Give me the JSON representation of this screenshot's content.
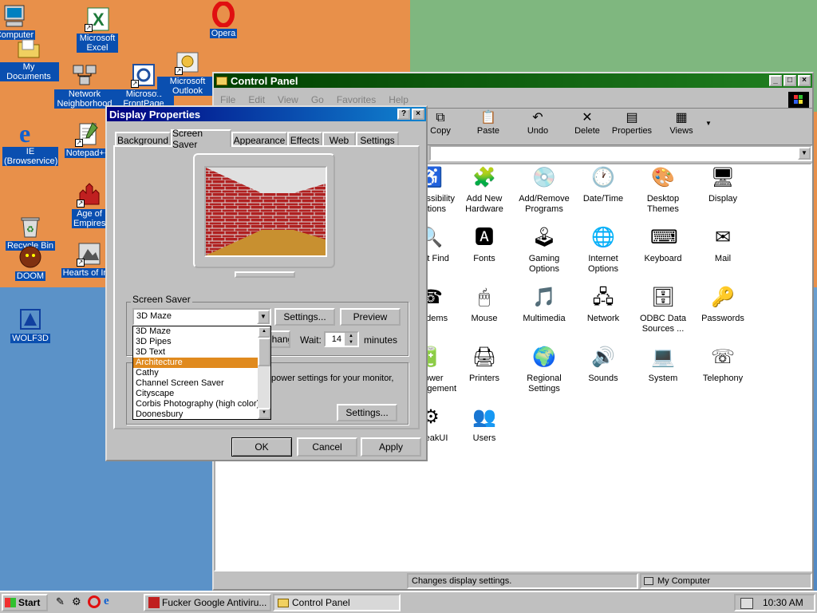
{
  "desktop": {
    "icons": [
      {
        "label": "Computer"
      },
      {
        "label": "My Documents"
      },
      {
        "label": "Microsoft Excel"
      },
      {
        "label": "Opera"
      },
      {
        "label": "Network Neighborhood"
      },
      {
        "label": "Microsoft FrontPage"
      },
      {
        "label": "Microsoft Outlook"
      },
      {
        "label": "IE (Browservice)"
      },
      {
        "label": "Notepad++"
      },
      {
        "label": "Age of Empires"
      },
      {
        "label": "Recycle Bin"
      },
      {
        "label": "DOOM"
      },
      {
        "label": "Hearts of Iron"
      },
      {
        "label": "WOLF3D"
      }
    ]
  },
  "control_panel": {
    "title": "Control Panel",
    "menu": [
      "File",
      "Edit",
      "View",
      "Go",
      "Favorites",
      "Help"
    ],
    "toolbar": [
      "Copy",
      "Paste",
      "Undo",
      "Delete",
      "Properties",
      "Views"
    ],
    "items": [
      {
        "label": "Accessibility Options"
      },
      {
        "label": "Add New Hardware"
      },
      {
        "label": "Add/Remove Programs"
      },
      {
        "label": "Date/Time"
      },
      {
        "label": "Desktop Themes"
      },
      {
        "label": "Display"
      },
      {
        "label": "Fast Find"
      },
      {
        "label": "Fonts"
      },
      {
        "label": "Gaming Options"
      },
      {
        "label": "Internet Options"
      },
      {
        "label": "Keyboard"
      },
      {
        "label": "Mail"
      },
      {
        "label": "Modems"
      },
      {
        "label": "Mouse"
      },
      {
        "label": "Multimedia"
      },
      {
        "label": "Network"
      },
      {
        "label": "ODBC Data Sources ..."
      },
      {
        "label": "Passwords"
      },
      {
        "label": "Power Management"
      },
      {
        "label": "Printers"
      },
      {
        "label": "Regional Settings"
      },
      {
        "label": "Sounds"
      },
      {
        "label": "System"
      },
      {
        "label": "Telephony"
      },
      {
        "label": "TweakUI"
      },
      {
        "label": "Users"
      }
    ],
    "status_left": "Changes display settings.",
    "status_right": "My Computer"
  },
  "display_properties": {
    "title": "Display Properties",
    "tabs": [
      "Background",
      "Screen Saver",
      "Appearance",
      "Effects",
      "Web",
      "Settings"
    ],
    "active_tab": "Screen Saver",
    "screen_saver_group": "Screen Saver",
    "selected": "3D Maze",
    "settings_btn": "Settings...",
    "preview_btn": "Preview",
    "password_btn": "Change...",
    "wait_label": "Wait:",
    "wait_value": "14",
    "minutes_label": "minutes",
    "dropdown_options": [
      "3D Maze",
      "3D Pipes",
      "3D Text",
      "Architecture",
      "Cathy",
      "Channel Screen Saver",
      "Cityscape",
      "Corbis Photography (high color)",
      "Doonesbury"
    ],
    "highlighted_option": "Architecture",
    "energy_text": "power settings for your monitor,",
    "energy_settings_btn": "Settings...",
    "ok": "OK",
    "cancel": "Cancel",
    "apply": "Apply"
  },
  "taskbar": {
    "start": "Start",
    "tasks": [
      {
        "label": "Fucker Google Antiviru..."
      },
      {
        "label": "Control Panel"
      }
    ],
    "clock": "10:30 AM"
  },
  "colors": {
    "title_active": "#000080",
    "title_inactive_cp": "#004000",
    "selection": "#e08a1e",
    "desktop_label_bg": "#0a4fb0"
  }
}
